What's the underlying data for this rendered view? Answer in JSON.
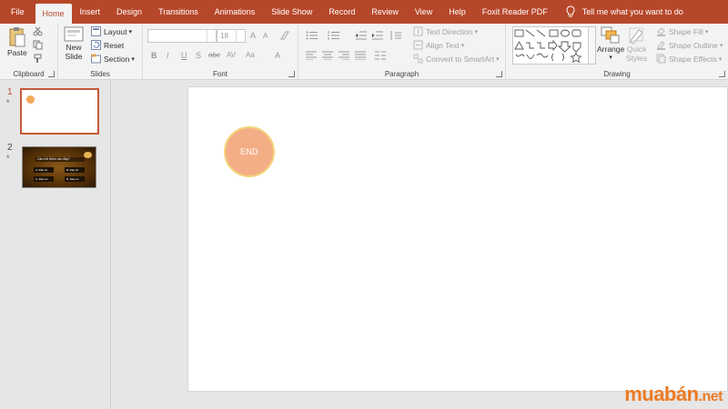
{
  "tabs": [
    {
      "label": "File",
      "active": false
    },
    {
      "label": "Home",
      "active": true
    },
    {
      "label": "Insert",
      "active": false
    },
    {
      "label": "Design",
      "active": false
    },
    {
      "label": "Transitions",
      "active": false
    },
    {
      "label": "Animations",
      "active": false
    },
    {
      "label": "Slide Show",
      "active": false
    },
    {
      "label": "Record",
      "active": false
    },
    {
      "label": "Review",
      "active": false
    },
    {
      "label": "View",
      "active": false
    },
    {
      "label": "Help",
      "active": false
    },
    {
      "label": "Foxit Reader PDF",
      "active": false
    }
  ],
  "tell_me": "Tell me what you want to do",
  "ribbon": {
    "clipboard": {
      "label": "Clipboard",
      "paste": "Paste"
    },
    "slides": {
      "label": "Slides",
      "new_slide_1": "New",
      "new_slide_2": "Slide",
      "layout": "Layout",
      "reset": "Reset",
      "section": "Section"
    },
    "font": {
      "label": "Font",
      "font_name": "",
      "font_size": "18",
      "bold": "B",
      "italic": "I",
      "underline": "U",
      "shadow": "S",
      "strike": "abc",
      "spacing": "AV",
      "case": "Aa",
      "color": "A",
      "grow": "A",
      "shrink": "A"
    },
    "paragraph": {
      "label": "Paragraph",
      "text_direction": "Text Direction",
      "align_text": "Align Text",
      "convert_smartart": "Convert to SmartArt"
    },
    "drawing": {
      "label": "Drawing",
      "arrange": "Arrange",
      "quick_styles_1": "Quick",
      "quick_styles_2": "Styles",
      "shape_fill": "Shape Fill",
      "shape_outline": "Shape Outline",
      "shape_effects": "Shape Effects"
    }
  },
  "slides_panel": {
    "slide1": {
      "number": "1",
      "marker": "*"
    },
    "slide2": {
      "number": "2",
      "marker": "*",
      "question": "Câu hỏi thêm vào đây?",
      "answers": [
        "A: Đáp án",
        "B: Đáp án",
        "C: Đáp án",
        "D: Đáp án"
      ]
    }
  },
  "slide": {
    "end_label": "END"
  },
  "watermark": {
    "main": "muabán",
    "suffix": ".net"
  },
  "colors": {
    "accent": "#b7472a",
    "end_fill": "#f4ae86",
    "end_border": "#f3d47a",
    "watermark": "#ec7a22"
  }
}
